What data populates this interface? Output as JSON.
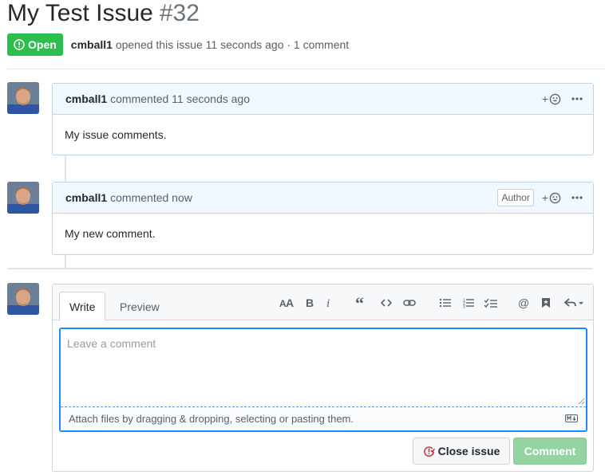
{
  "issue": {
    "title": "My Test Issue",
    "number": "#32",
    "state": "Open",
    "author": "cmball1",
    "opened_text": "opened this issue 11 seconds ago · 1 comment"
  },
  "comments": [
    {
      "author": "cmball1",
      "action": "commented 11 seconds ago",
      "body": "My issue comments.",
      "author_label": ""
    },
    {
      "author": "cmball1",
      "action": "commented now",
      "body": "My new comment.",
      "author_label": "Author"
    }
  ],
  "reaction": {
    "plus": "+"
  },
  "editor": {
    "tabs": [
      "Write",
      "Preview"
    ],
    "placeholder": "Leave a comment",
    "attach_text": "Attach files by dragging & dropping, selecting or pasting them.",
    "toolbar_icons": [
      "text-size-icon",
      "bold-icon",
      "italic-icon",
      "quote-icon",
      "code-icon",
      "link-icon",
      "bulleted-list-icon",
      "numbered-list-icon",
      "task-list-icon",
      "mention-icon",
      "reference-icon",
      "reply-icon"
    ],
    "close_label": "Close issue",
    "comment_label": "Comment"
  },
  "colors": {
    "open_badge": "#2cbe4e",
    "comment_header": "#f1f8ff",
    "focus_border": "#2188ff",
    "comment_button_disabled": "#94d3a2"
  }
}
